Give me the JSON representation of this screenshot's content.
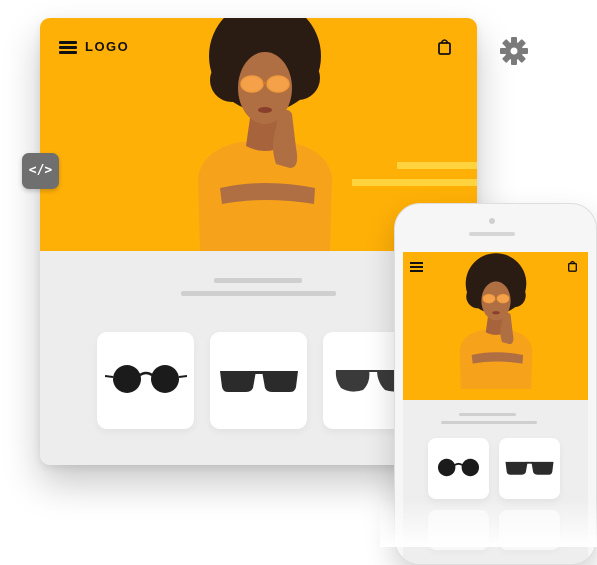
{
  "desktop": {
    "logo_text": "LOGO",
    "menu_icon": "hamburger-menu-icon",
    "cart_icon": "shopping-bag-icon",
    "hero_image": "woman-with-orange-sunglasses-photo",
    "products": [
      {
        "icon": "round-sunglasses-icon"
      },
      {
        "icon": "square-sunglasses-icon"
      },
      {
        "icon": "aviator-sunglasses-icon"
      }
    ]
  },
  "phone": {
    "menu_icon": "hamburger-menu-icon",
    "cart_icon": "shopping-bag-icon",
    "products": [
      {
        "icon": "round-sunglasses-icon"
      },
      {
        "icon": "square-sunglasses-icon"
      }
    ]
  },
  "tools": {
    "settings_icon": "gear-icon",
    "code_label": "</>"
  },
  "colors": {
    "accent": "#ffb007",
    "stripe": "#ffd33d",
    "page_bg": "#ededed"
  }
}
